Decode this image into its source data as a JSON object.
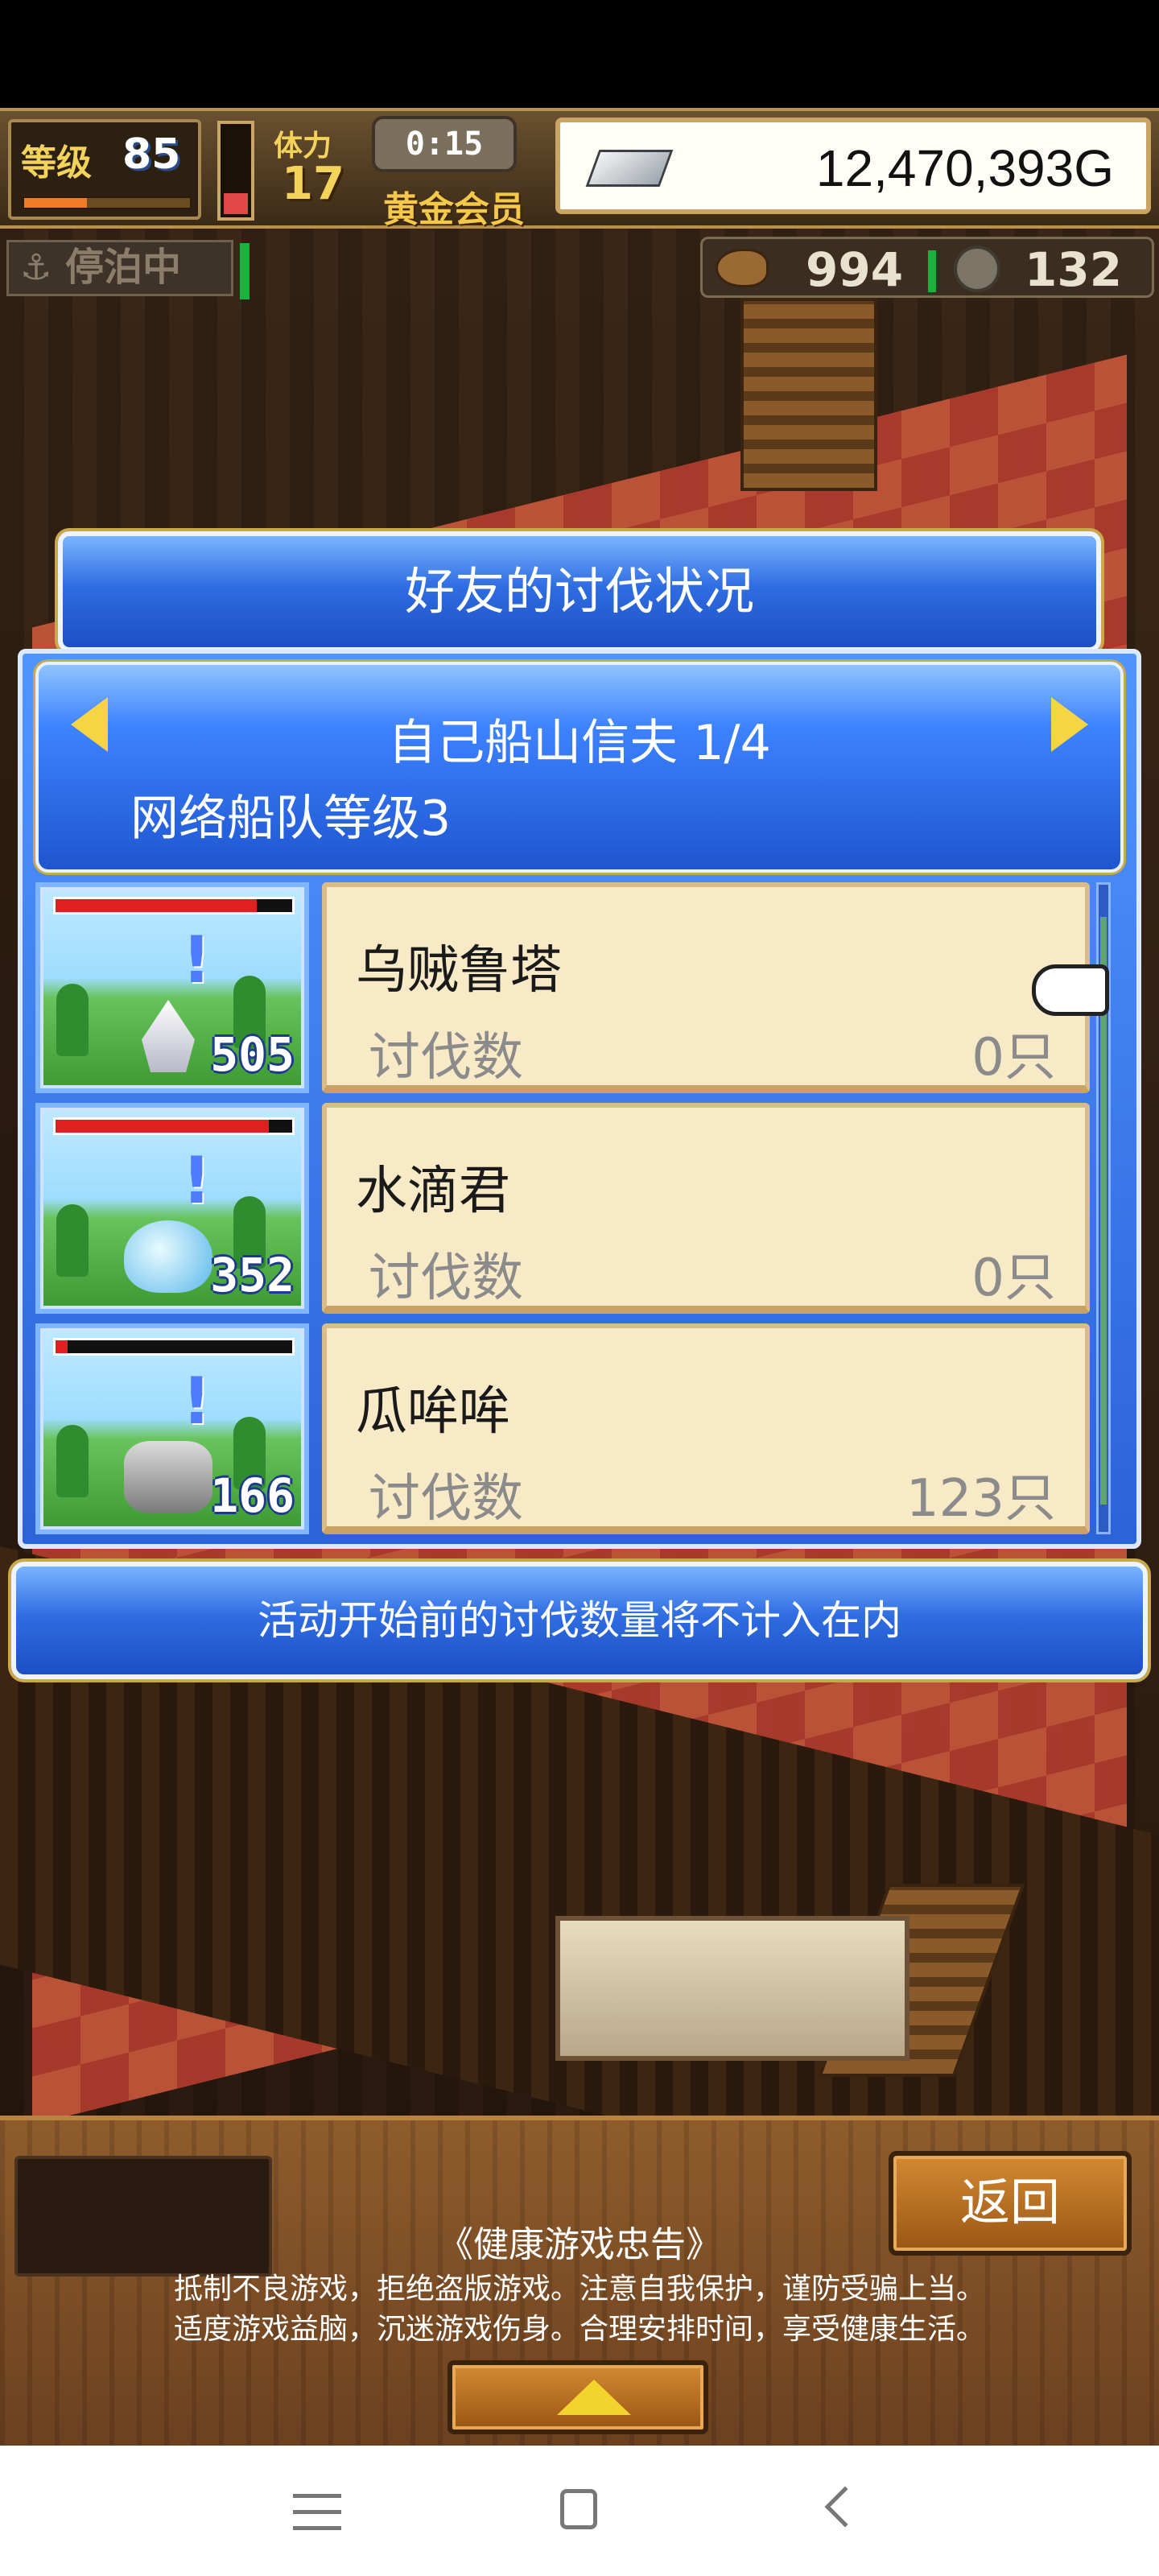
{
  "hud": {
    "level_label": "等级",
    "level": "85",
    "stamina_label": "体力",
    "stamina": "17",
    "timer": "0:15",
    "membership": "黄金会员",
    "gold": "12,470,393G",
    "status": "停泊中",
    "resource1": "994",
    "resource2": "132"
  },
  "dialog": {
    "title": "好友的讨伐状况",
    "friend_name": "自己船山信夫 1/4",
    "fleet_level": "网络船队等级3",
    "notice": "活动开始前的讨伐数量将不计入在内",
    "monsters": [
      {
        "name": "乌贼鲁塔",
        "kill_label": "讨伐数",
        "kills": "0只",
        "level_number": "505",
        "hp_fraction": 0.85
      },
      {
        "name": "水滴君",
        "kill_label": "讨伐数",
        "kills": "0只",
        "level_number": "352",
        "hp_fraction": 0.9
      },
      {
        "name": "瓜哞哞",
        "kill_label": "讨伐数",
        "kills": "123只",
        "level_number": "166",
        "hp_fraction": 0.05
      }
    ]
  },
  "bottom": {
    "back_label": "返回",
    "health_title": "《健康游戏忠告》",
    "health_line1": "抵制不良游戏，拒绝盗版游戏。注意自我保护，谨防受骗上当。",
    "health_line2": "适度游戏益脑，沉迷游戏伤身。合理安排时间，享受健康生活。"
  },
  "colors": {
    "dialog_blue": "#2f6de2",
    "card_bg": "#f8e9c7",
    "gold": "#f4d35a"
  },
  "icons": [
    "anchor-icon",
    "silver-bar-icon",
    "coin-icon",
    "meat-icon",
    "arrow-left-icon",
    "arrow-right-icon",
    "pointing-hand-icon",
    "arrow-up-icon"
  ]
}
